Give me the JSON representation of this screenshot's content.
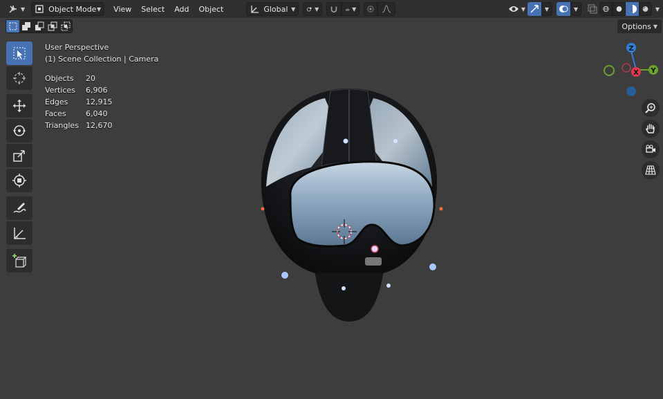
{
  "header": {
    "mode": "Object Mode",
    "menus": [
      "View",
      "Select",
      "Add",
      "Object"
    ],
    "transform_orientation": "Global"
  },
  "options_label": "Options",
  "overlay": {
    "perspective": "User Perspective",
    "collection": "(1) Scene Collection | Camera",
    "stats": [
      {
        "label": "Objects",
        "value": "20"
      },
      {
        "label": "Vertices",
        "value": "6,906"
      },
      {
        "label": "Edges",
        "value": "12,915"
      },
      {
        "label": "Faces",
        "value": "6,040"
      },
      {
        "label": "Triangles",
        "value": "12,670"
      }
    ]
  },
  "gizmo": {
    "x_label": "X",
    "y_label": "Y",
    "z_label": "Z",
    "x_color": "#e0384e",
    "y_color": "#6ba12e",
    "z_color": "#2f7fd8"
  },
  "colors": {
    "viewport_bg": "#3d3d3d",
    "header_bg": "#303030",
    "accent": "#4772b3"
  },
  "icons": {
    "toolbar": [
      "select-box-icon",
      "cursor-icon",
      "move-icon",
      "rotate-icon",
      "scale-icon",
      "transform-icon",
      "annotate-icon",
      "measure-icon",
      "add-cube-icon"
    ],
    "nav": [
      "zoom-icon",
      "pan-hand-icon",
      "camera-view-icon",
      "ortho-grid-icon"
    ]
  }
}
